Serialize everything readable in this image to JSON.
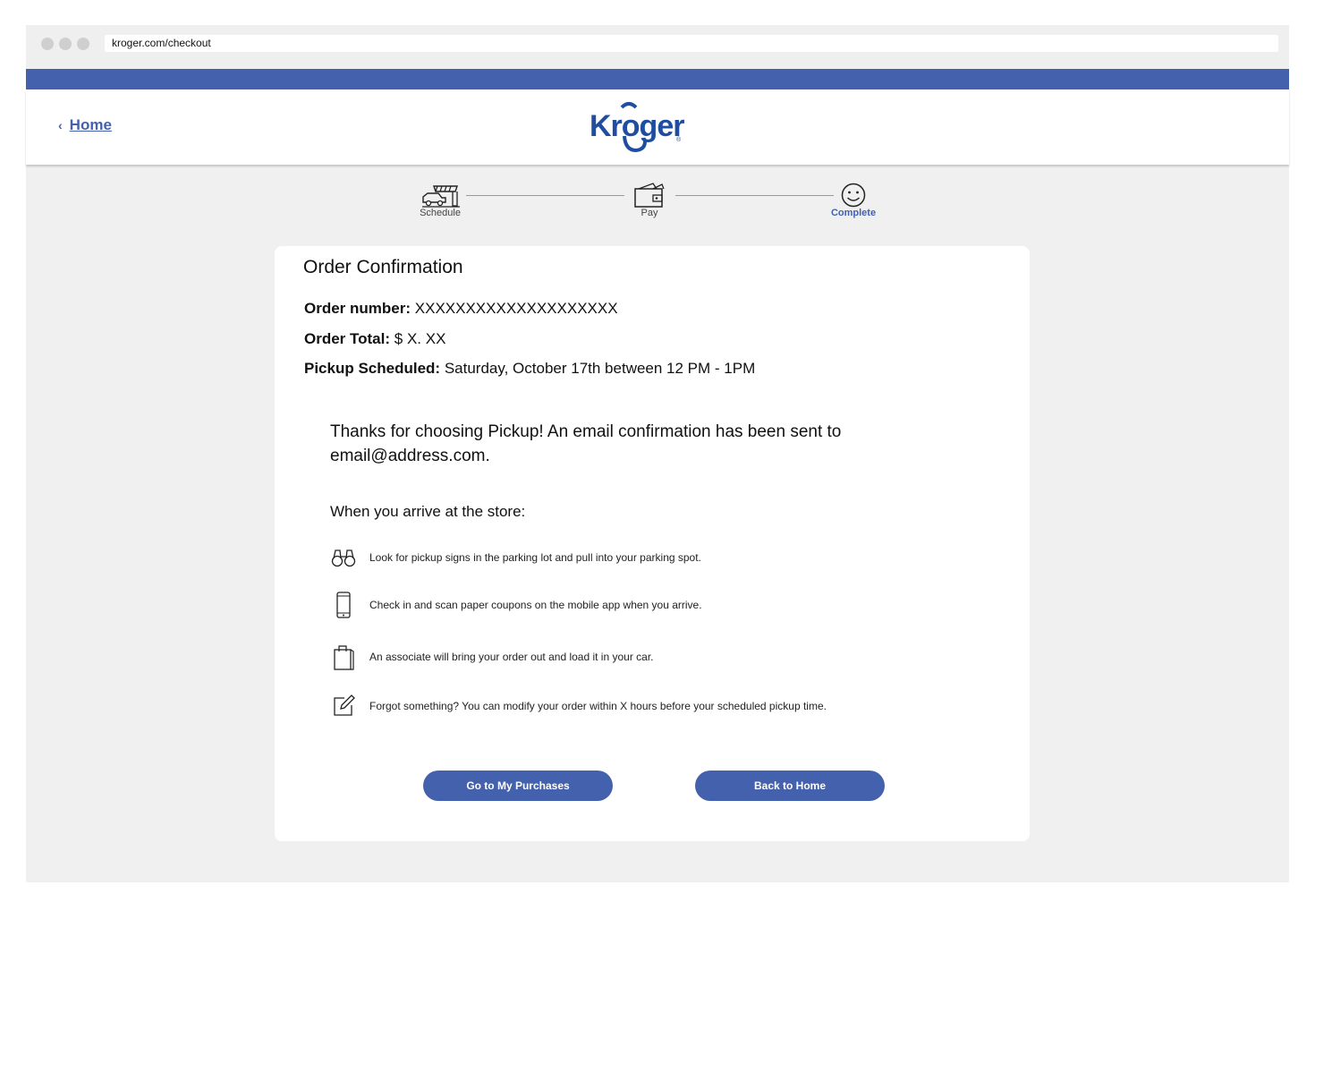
{
  "browser": {
    "url": "kroger.com/checkout"
  },
  "header": {
    "home_label": "Home",
    "logo_text": "Kroger"
  },
  "steps": [
    {
      "label": "Schedule",
      "icon": "delivery-truck-icon",
      "active": false
    },
    {
      "label": "Pay",
      "icon": "wallet-icon",
      "active": false
    },
    {
      "label": "Complete",
      "icon": "smiley-icon",
      "active": true
    }
  ],
  "confirmation": {
    "title": "Order Confirmation",
    "order_number_label": "Order number:",
    "order_number_value": "XXXXXXXXXXXXXXXXXXXX",
    "order_total_label": "Order Total:",
    "order_total_value": "$ X. XX",
    "pickup_label": "Pickup Scheduled:",
    "pickup_value": "Saturday, October 17th between 12 PM - 1PM",
    "thanks_message": "Thanks for choosing Pickup! An email confirmation has been sent to email@address.com.",
    "arrive_heading": "When you arrive at the store:",
    "tips": [
      {
        "icon": "binoculars-icon",
        "text": "Look for pickup signs in the parking lot and pull into your parking spot."
      },
      {
        "icon": "smartphone-icon",
        "text": "Check in and scan paper coupons on the mobile app when you arrive."
      },
      {
        "icon": "shopping-bag-icon",
        "text": "An associate will bring your order out and load it in your car."
      },
      {
        "icon": "edit-icon",
        "text": "Forgot something? You can modify your order within X hours before your scheduled pickup time."
      }
    ]
  },
  "buttons": {
    "purchases_label": "Go to My Purchases",
    "home_label": "Back to Home"
  },
  "colors": {
    "brand": "#4461ad",
    "background": "#f0f0f0"
  }
}
